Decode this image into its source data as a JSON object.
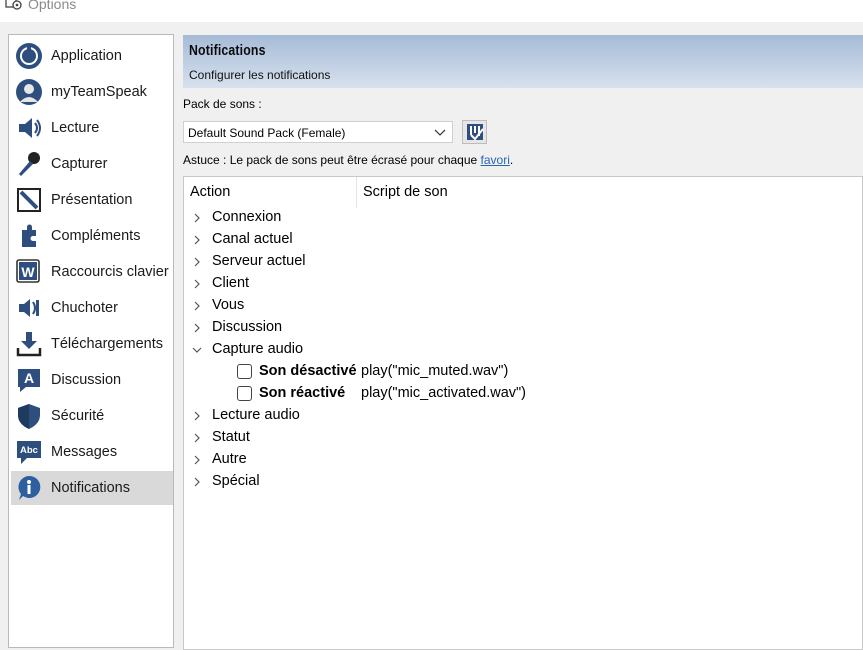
{
  "window": {
    "title": "Options"
  },
  "sidebar": {
    "items": [
      {
        "label": "Application",
        "icon": "teamspeak-logo-icon"
      },
      {
        "label": "myTeamSpeak",
        "icon": "user-profile-icon"
      },
      {
        "label": "Lecture",
        "icon": "speaker-icon"
      },
      {
        "label": "Capturer",
        "icon": "microphone-icon"
      },
      {
        "label": "Présentation",
        "icon": "design-pencil-icon"
      },
      {
        "label": "Compléments",
        "icon": "puzzle-icon"
      },
      {
        "label": "Raccourcis clavier",
        "icon": "keyboard-w-icon"
      },
      {
        "label": "Chuchoter",
        "icon": "whisper-speaker-icon"
      },
      {
        "label": "Téléchargements",
        "icon": "download-icon"
      },
      {
        "label": "Discussion",
        "icon": "chat-a-icon"
      },
      {
        "label": "Sécurité",
        "icon": "shield-icon"
      },
      {
        "label": "Messages",
        "icon": "message-abc-icon"
      },
      {
        "label": "Notifications",
        "icon": "info-icon"
      }
    ],
    "selected": "Notifications"
  },
  "header": {
    "title": "Notifications",
    "subtitle": "Configurer les notifications"
  },
  "sound_pack": {
    "label": "Pack de sons :",
    "selected": "Default Sound Pack (Female)"
  },
  "tip": {
    "prefix": "Astuce : Le pack de sons peut être écrasé pour chaque ",
    "link": "favori",
    "suffix": "."
  },
  "tree": {
    "columns": [
      "Action",
      "Script de son"
    ],
    "rows": [
      {
        "label": "Connexion",
        "expanded": false
      },
      {
        "label": "Canal actuel",
        "expanded": false
      },
      {
        "label": "Serveur actuel",
        "expanded": false
      },
      {
        "label": "Client",
        "expanded": false
      },
      {
        "label": "Vous",
        "expanded": false
      },
      {
        "label": "Discussion",
        "expanded": false
      },
      {
        "label": "Capture audio",
        "expanded": true,
        "children": [
          {
            "label": "Son désactivé",
            "script": "play(\"mic_muted.wav\")",
            "checked": false
          },
          {
            "label": "Son réactivé",
            "script": "play(\"mic_activated.wav\")",
            "checked": false
          }
        ]
      },
      {
        "label": "Lecture audio",
        "expanded": false
      },
      {
        "label": "Statut",
        "expanded": false
      },
      {
        "label": "Autre",
        "expanded": false
      },
      {
        "label": "Spécial",
        "expanded": false
      }
    ]
  },
  "colors": {
    "accent": "#a6bbd7",
    "link": "#2a64b8",
    "selected_bg": "#d9d9d9"
  }
}
